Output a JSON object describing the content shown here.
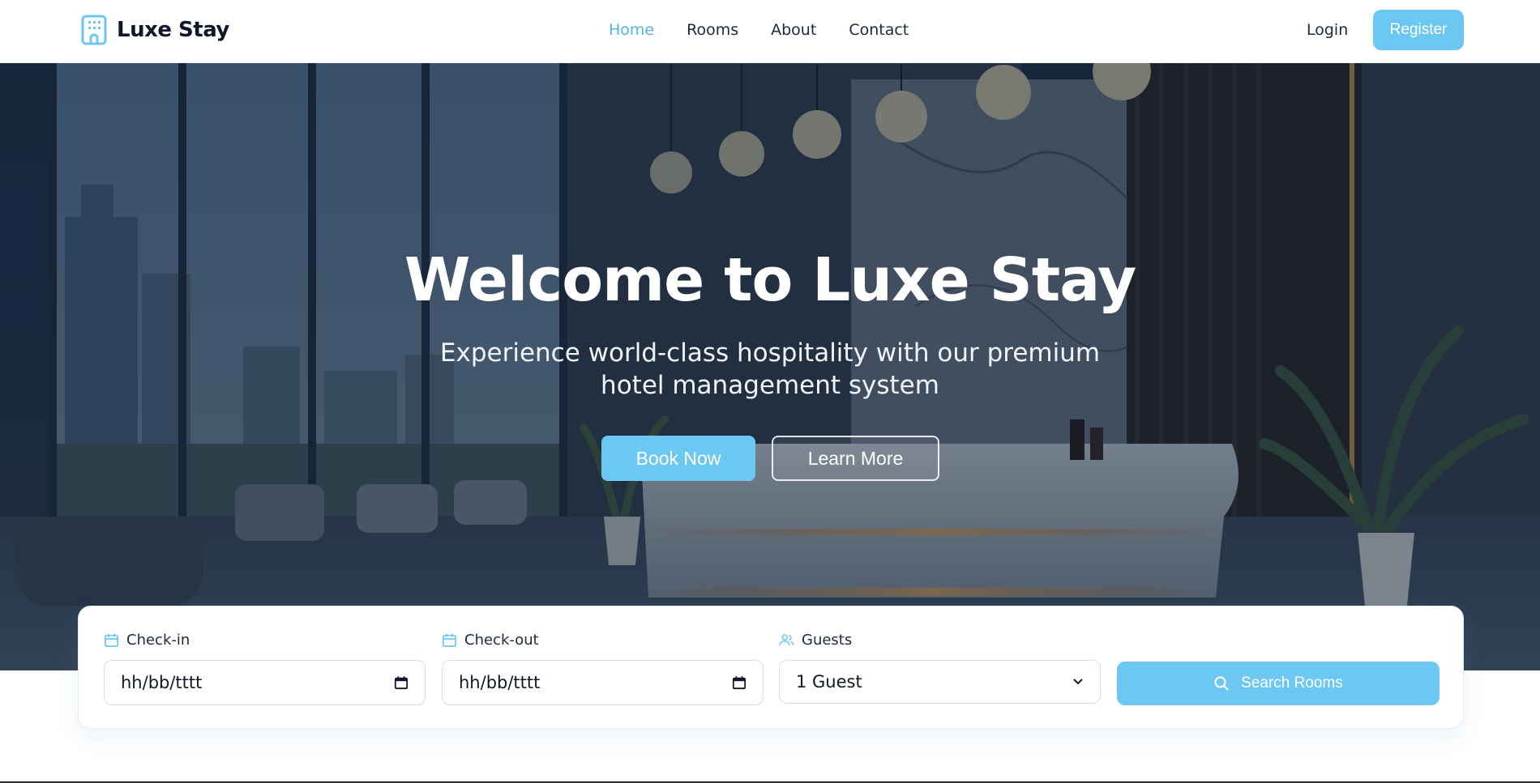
{
  "brand": {
    "name": "Luxe Stay"
  },
  "nav": {
    "links": [
      {
        "label": "Home",
        "active": true
      },
      {
        "label": "Rooms",
        "active": false
      },
      {
        "label": "About",
        "active": false
      },
      {
        "label": "Contact",
        "active": false
      }
    ],
    "login_label": "Login",
    "register_label": "Register"
  },
  "hero": {
    "title": "Welcome to Luxe Stay",
    "subtitle": "Experience world-class hospitality with our premium hotel management system",
    "book_label": "Book Now",
    "learn_label": "Learn More"
  },
  "search": {
    "checkin": {
      "label": "Check-in",
      "value": "hh/bb/tttt",
      "icon": "calendar-icon"
    },
    "checkout": {
      "label": "Check-out",
      "value": "hh/bb/tttt",
      "icon": "calendar-icon"
    },
    "guests": {
      "label": "Guests",
      "value": "1 Guest",
      "icon": "users-icon"
    },
    "button_label": "Search Rooms",
    "button_icon": "search-icon"
  },
  "colors": {
    "accent": "#6cc7f3",
    "nav_active": "#4fb8ea",
    "text_dark": "#0f172a"
  }
}
